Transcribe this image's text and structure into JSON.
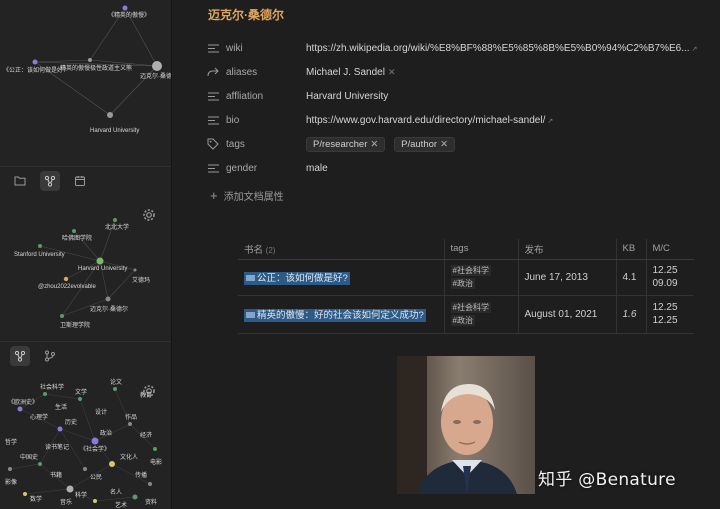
{
  "graph_top": {
    "nodes": [
      "《精英的傲慢》",
      "《公正：该如何做是好？",
      "精英的傲慢极性政道主义熊",
      "迈克尔·桑德尔",
      "Harvard University"
    ]
  },
  "graph_mid": {
    "nodes": [
      "北北大学",
      "哈佛图学院",
      "Stanford University",
      "Harvard University",
      "艾德玛",
      "@zhou2022evolvable",
      "迈克尔·桑德尔",
      "卫斯理学院"
    ]
  },
  "graph_big": {
    "nodes": [
      "《欧洲史》",
      "社会科学",
      "文学",
      "论文",
      "作品",
      "心理学",
      "历史",
      "政治",
      "哲学",
      "经济",
      "《社会学》",
      "文化人",
      "中国史",
      "书籍",
      "公民",
      "传播",
      "影像",
      "科学",
      "名人",
      "数学",
      "资料",
      "生活",
      "设计",
      "教育",
      "读书笔记",
      "电影",
      "音乐",
      "艺术"
    ]
  },
  "page": {
    "title": "迈克尔·桑德尔",
    "properties": [
      {
        "key": "wiki",
        "icon": "lines-icon",
        "value": "https://zh.wikipedia.org/wiki/%E8%BF%88%E5%85%8B%E5%B0%94%C2%B7%E6..."
      },
      {
        "key": "aliases",
        "icon": "arrow-icon",
        "value": "Michael J. Sandel"
      },
      {
        "key": "affliation",
        "icon": "lines-icon",
        "value": "Harvard University"
      },
      {
        "key": "bio",
        "icon": "lines-icon",
        "value": "https://www.gov.harvard.edu/directory/michael-sandel/"
      },
      {
        "key": "tags",
        "icon": "tag-icon",
        "tags": [
          "P/researcher",
          "P/author"
        ]
      },
      {
        "key": "gender",
        "icon": "lines-icon",
        "value": "male"
      }
    ],
    "add_property": "添加文档属性"
  },
  "table": {
    "headers": {
      "name": "书名",
      "count": "(2)",
      "tags": "tags",
      "published": "发布",
      "kb": "KB",
      "mc": "M/C"
    },
    "rows": [
      {
        "name": "公正：该如何做是好?",
        "tags": [
          "#社会科学",
          "#政治"
        ],
        "published": "June 17, 2013",
        "kb": "4.1",
        "mc": [
          "12.25",
          "09.09"
        ]
      },
      {
        "name": "精英的傲慢：好的社会该如何定义成功?",
        "tags": [
          "#社会科学",
          "#政治"
        ],
        "published": "August 01, 2021",
        "kb": "1.6",
        "mc": [
          "12.25",
          "12.25"
        ]
      }
    ]
  },
  "watermark": "知乎 @Benature",
  "colors": {
    "accent": "#e0a55e",
    "link": "#7aa3c9",
    "selection": "#2e5a86"
  }
}
